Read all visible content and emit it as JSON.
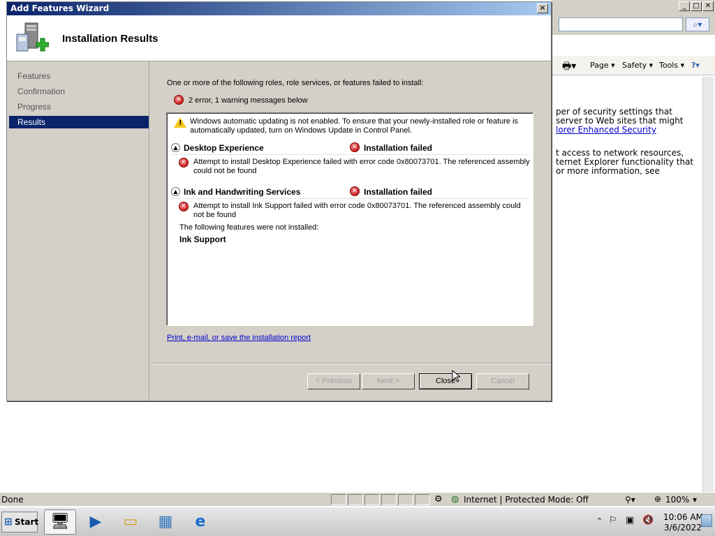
{
  "ie": {
    "min": "_",
    "max": "□",
    "close": "✕",
    "cmd": {
      "page": "Page ▾",
      "safety": "Safety ▾",
      "tools": "Tools ▾"
    },
    "content_lines": [
      "per of security settings that",
      "server to Web sites that might",
      "lorer Enhanced Security",
      "",
      "t access to network resources,",
      "ternet Explorer functionality that",
      "or more information, see"
    ],
    "status": {
      "left": "Done",
      "zone": "Internet | Protected Mode: Off",
      "zoom": "100%"
    }
  },
  "taskbar": {
    "start_label": "Start",
    "clock_time": "10:06 AM",
    "clock_date": "3/6/2022"
  },
  "dialog": {
    "title": "Add Features Wizard",
    "header_title": "Installation Results",
    "nav_items": [
      "Features",
      "Confirmation",
      "Progress",
      "Results"
    ],
    "intro": "One or more of the following roles, role services, or features failed to install:",
    "summary": "2 error, 1 warning messages below",
    "warning_line1": "Windows automatic updating is not enabled. To ensure that your newly-installed role or feature is",
    "warning_line2": "automatically updated, turn on Windows Update in Control Panel.",
    "sections": [
      {
        "name": "Desktop Experience",
        "status": "Installation failed",
        "msg1": "Attempt to install Desktop Experience failed with error code 0x80073701.  The referenced assembly",
        "msg2": "could not be found"
      },
      {
        "name": "Ink and Handwriting Services",
        "status": "Installation failed",
        "msg1": "Attempt to install Ink Support failed with error code 0x80073701.  The referenced assembly could",
        "msg2": "not be found",
        "not_installed_label": "The following features were not installed:",
        "not_installed_item": "Ink Support"
      }
    ],
    "report_link": "Print, e-mail, or save the installation report",
    "buttons": {
      "previous": "< Previous",
      "next": "Next >",
      "close": "Close",
      "cancel": "Cancel"
    }
  },
  "colors": {
    "title_start": "#0a246a",
    "title_end": "#a6caf0",
    "selected_nav": "#0a246a",
    "error_red": "#c00000",
    "warning_yellow": "#f5c518",
    "link_blue": "#0000cc"
  }
}
